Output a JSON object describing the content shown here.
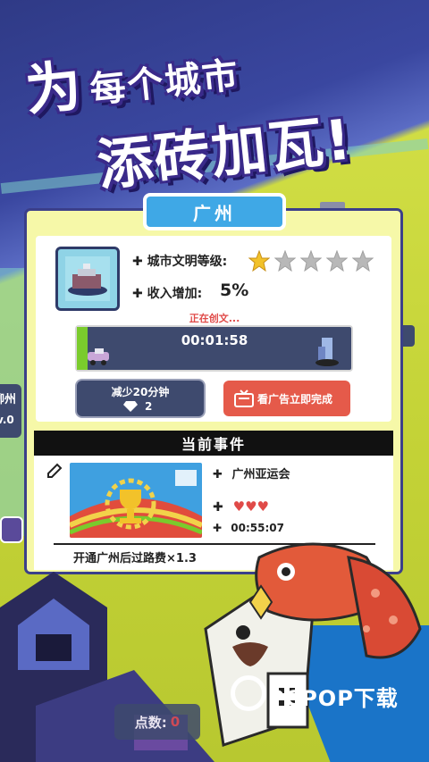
{
  "headline": {
    "line1_big": "为",
    "line1_small": "每个城市",
    "line2": "添砖加瓦!"
  },
  "city": {
    "name": "广州",
    "side_city_fragment": "柳州",
    "side_level_fragment": "v.0"
  },
  "info": {
    "civ_label": "城市文明等级:",
    "civ_level": 1,
    "civ_max": 5,
    "income_label": "收入增加:",
    "income_value": "5%",
    "status_text": "正在创文...",
    "timer": "00:01:58",
    "progress_fraction": 0.04
  },
  "buttons": {
    "reduce_label": "减少20分钟",
    "reduce_cost": "2",
    "ad_label": "看广告立即完成"
  },
  "event": {
    "header": "当前事件",
    "name": "广州亚运会",
    "hearts": 3,
    "timer": "00:55:07",
    "bonus_text": "开通广州后过路费×1.3"
  },
  "score": {
    "label": "点数:",
    "value": "0"
  },
  "watermark": "PCPOP下载",
  "colors": {
    "accent_blue": "#3fa8e6",
    "ad_red": "#e55a4a",
    "card_yellow": "#f6f8a8",
    "progress_green": "#7acb2c"
  }
}
